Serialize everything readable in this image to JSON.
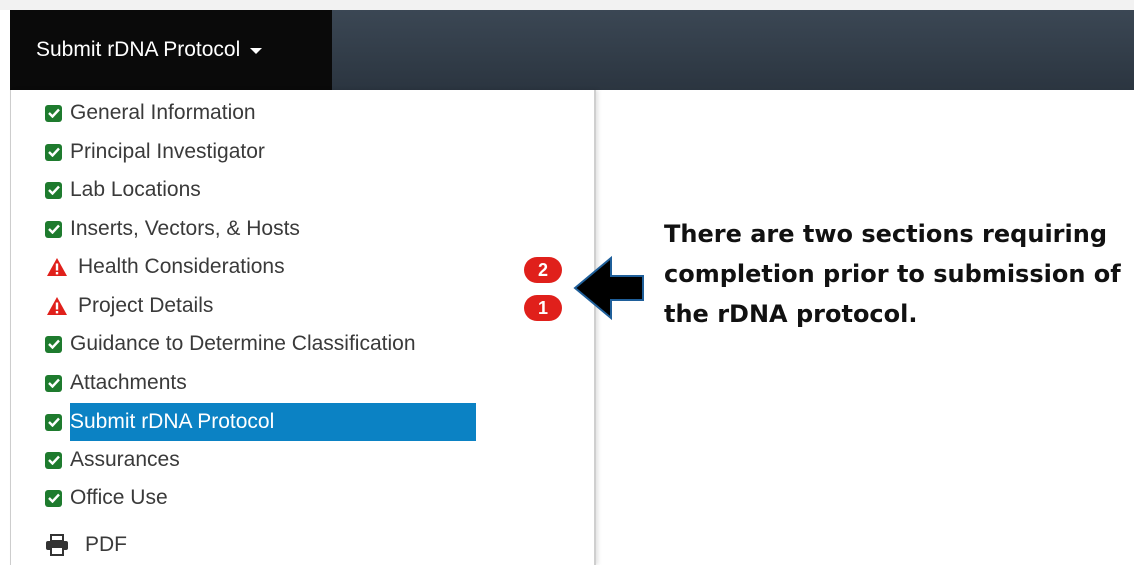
{
  "navbar": {
    "dropdown_label": "Submit rDNA Protocol"
  },
  "menu": {
    "items": [
      {
        "label": "General Information",
        "status": "complete",
        "icon": "check-square-icon"
      },
      {
        "label": "Principal Investigator",
        "status": "complete",
        "icon": "check-square-icon"
      },
      {
        "label": "Lab Locations",
        "status": "complete",
        "icon": "check-square-icon"
      },
      {
        "label": "Inserts, Vectors, & Hosts",
        "status": "complete",
        "icon": "check-square-icon"
      },
      {
        "label": "Health Considerations",
        "status": "warning",
        "icon": "warning-triangle-icon",
        "badge": "2"
      },
      {
        "label": "Project Details",
        "status": "warning",
        "icon": "warning-triangle-icon",
        "badge": "1"
      },
      {
        "label": "Guidance to Determine Classification",
        "status": "complete",
        "icon": "check-square-icon"
      },
      {
        "label": "Attachments",
        "status": "complete",
        "icon": "check-square-icon"
      },
      {
        "label": "Submit rDNA Protocol",
        "status": "complete",
        "icon": "check-square-icon",
        "active": true
      },
      {
        "label": "Assurances",
        "status": "complete",
        "icon": "check-square-icon"
      },
      {
        "label": "Office Use",
        "status": "complete",
        "icon": "check-square-icon"
      }
    ],
    "pdf": {
      "label": "PDF",
      "icon": "printer-icon"
    }
  },
  "callout": {
    "text": "There are two sections requiring completion prior to submission of the rDNA protocol."
  },
  "colors": {
    "navbar": "#2b3540",
    "dropdown": "#0a0a0a",
    "check": "#1e7b2e",
    "warning": "#e0201b",
    "active": "#0b82c4",
    "arrow": "#000000"
  }
}
